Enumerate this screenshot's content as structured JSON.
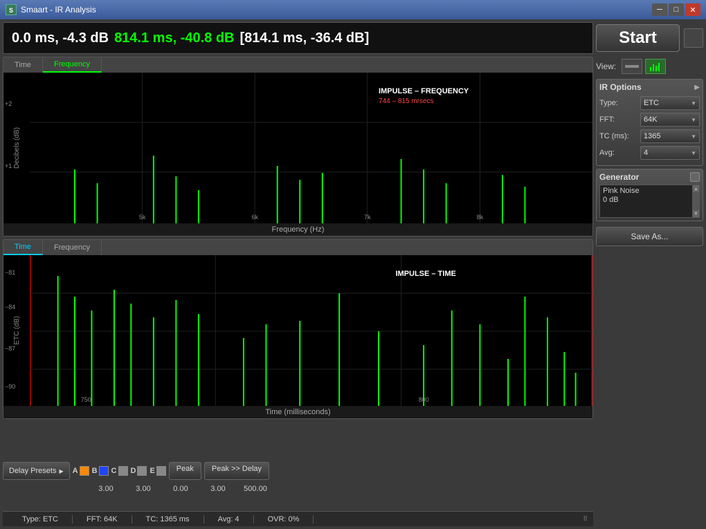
{
  "window": {
    "title": "Smaart - IR Analysis",
    "icon_label": "S"
  },
  "header_display": {
    "part1": "0.0 ms, -4.3 dB",
    "part2": "814.1 ms, -40.8 dB",
    "part3": "[814.1 ms, -36.4 dB]"
  },
  "freq_chart": {
    "tab_time": "Time",
    "tab_freq": "Frequency",
    "overlay_title": "IMPULSE – FREQUENCY",
    "overlay_range": "744 – 815 mrsecs",
    "x_label": "Frequency (Hz)",
    "y_ticks": [
      "+2",
      "+1"
    ],
    "y_label": "Decibels (dB)",
    "x_ticks": [
      "5k",
      "6k",
      "7k",
      "8k"
    ]
  },
  "time_chart": {
    "tab_time": "Time",
    "tab_freq": "Frequency",
    "overlay_title": "IMPULSE – TIME",
    "x_label": "Time (milliseconds)",
    "y_ticks": [
      "-81",
      "-84",
      "-87",
      "-90"
    ],
    "y_label": "ETC (dB)",
    "x_ticks": [
      "750",
      "800"
    ]
  },
  "bottom_controls": {
    "delay_presets_label": "Delay Presets",
    "channels": [
      {
        "label": "A",
        "color": "#ff8800"
      },
      {
        "label": "B",
        "color": "#2244ff"
      },
      {
        "label": "C",
        "color": "#888888"
      },
      {
        "label": "D",
        "color": "#888888"
      },
      {
        "label": "E",
        "color": "#888888"
      }
    ],
    "peak_label": "Peak",
    "peak_delay_label": "Peak >> Delay",
    "values": [
      "3.00",
      "3.00",
      "0.00",
      "3.00",
      "500.00"
    ]
  },
  "status_bar": {
    "type": "Type: ETC",
    "fft": "FFT: 64K",
    "tc": "TC: 1365 ms",
    "avg": "Avg: 4",
    "ovr": "OVR: 0%"
  },
  "right_panel": {
    "start_label": "Start",
    "view_label": "View:",
    "ir_options": {
      "title": "IR Options",
      "type_label": "Type:",
      "type_value": "ETC",
      "fft_label": "FFT:",
      "fft_value": "64K",
      "tc_label": "TC (ms):",
      "tc_value": "1365",
      "avg_label": "Avg:",
      "avg_value": "4"
    },
    "generator": {
      "title": "Generator",
      "noise_type": "Pink Noise",
      "level": "0 dB"
    },
    "save_as_label": "Save As..."
  }
}
